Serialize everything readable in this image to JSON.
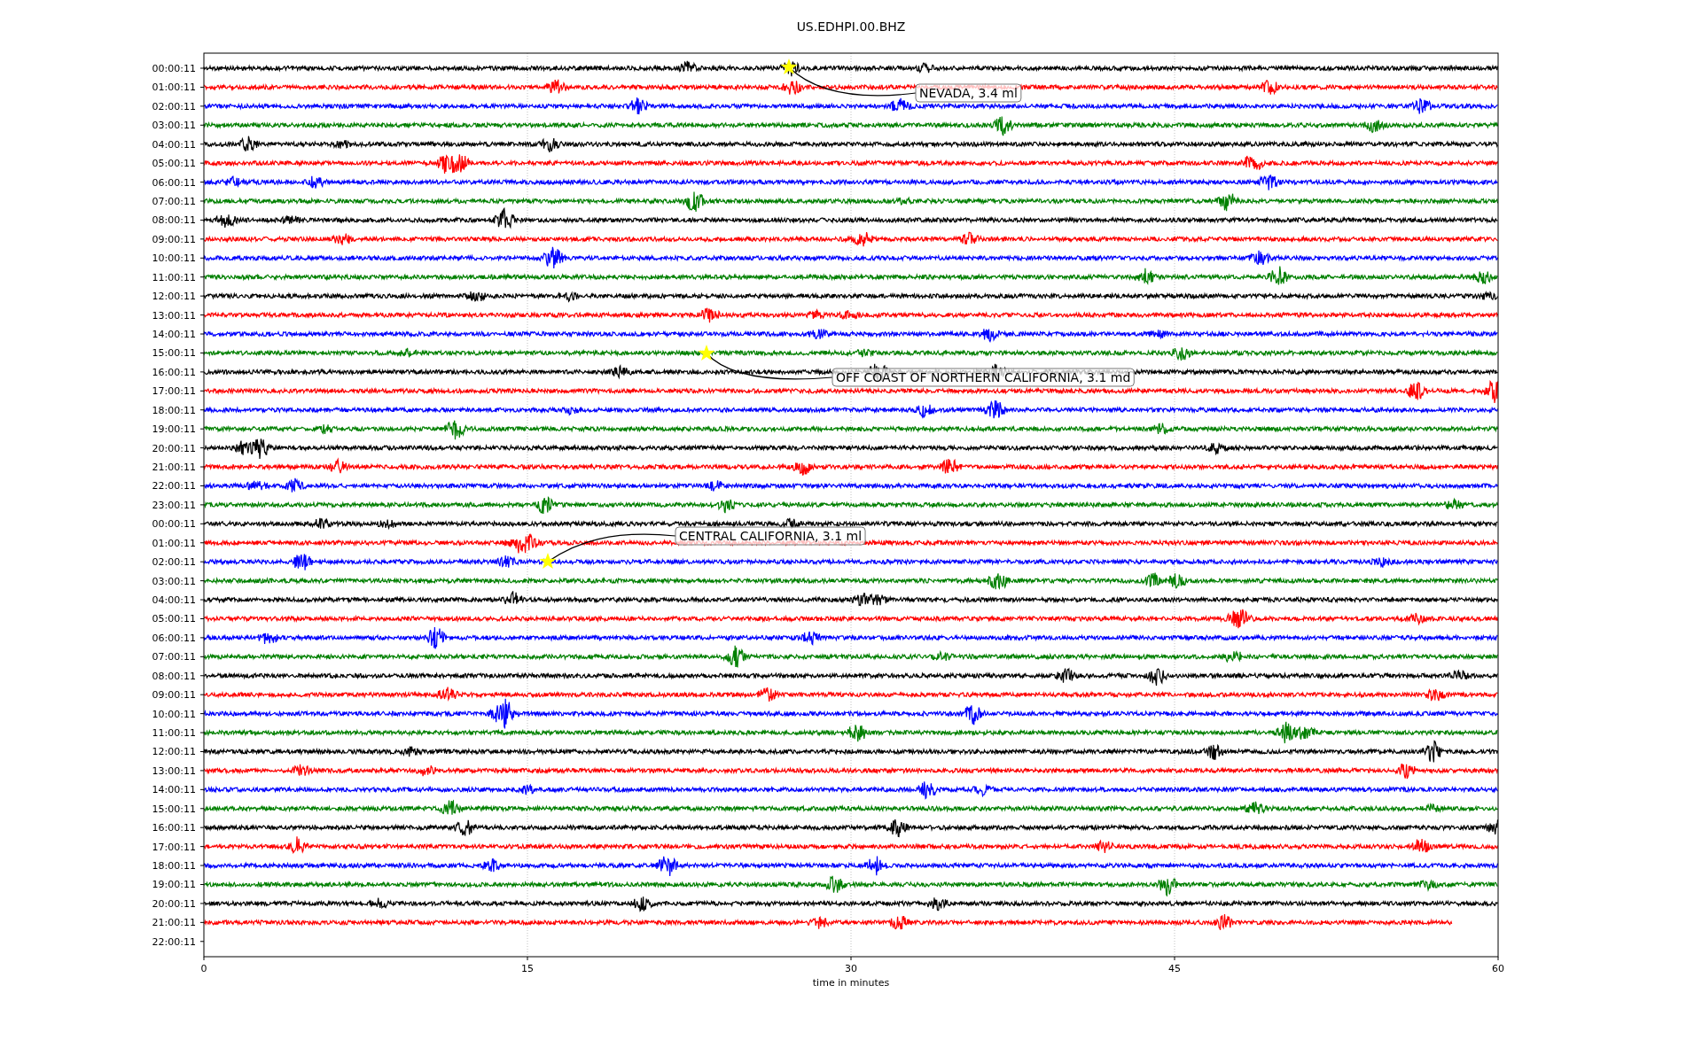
{
  "title": "US.EDHPI.00.BHZ",
  "rows": [
    {
      "label": "00:00:11",
      "color": "#000000",
      "kind": "full"
    },
    {
      "label": "01:00:11",
      "color": "#ff0000",
      "kind": "full"
    },
    {
      "label": "02:00:11",
      "color": "#0000ff",
      "kind": "full"
    },
    {
      "label": "03:00:11",
      "color": "#008000",
      "kind": "full"
    },
    {
      "label": "04:00:11",
      "color": "#000000",
      "kind": "full"
    },
    {
      "label": "05:00:11",
      "color": "#ff0000",
      "kind": "full"
    },
    {
      "label": "06:00:11",
      "color": "#0000ff",
      "kind": "full"
    },
    {
      "label": "07:00:11",
      "color": "#008000",
      "kind": "full"
    },
    {
      "label": "08:00:11",
      "color": "#000000",
      "kind": "full"
    },
    {
      "label": "09:00:11",
      "color": "#ff0000",
      "kind": "full"
    },
    {
      "label": "10:00:11",
      "color": "#0000ff",
      "kind": "full"
    },
    {
      "label": "11:00:11",
      "color": "#008000",
      "kind": "full"
    },
    {
      "label": "12:00:11",
      "color": "#000000",
      "kind": "full"
    },
    {
      "label": "13:00:11",
      "color": "#ff0000",
      "kind": "full"
    },
    {
      "label": "14:00:11",
      "color": "#0000ff",
      "kind": "full"
    },
    {
      "label": "15:00:11",
      "color": "#008000",
      "kind": "full"
    },
    {
      "label": "16:00:11",
      "color": "#000000",
      "kind": "full"
    },
    {
      "label": "17:00:11",
      "color": "#ff0000",
      "kind": "full"
    },
    {
      "label": "18:00:11",
      "color": "#0000ff",
      "kind": "full"
    },
    {
      "label": "19:00:11",
      "color": "#008000",
      "kind": "full"
    },
    {
      "label": "20:00:11",
      "color": "#000000",
      "kind": "full"
    },
    {
      "label": "21:00:11",
      "color": "#ff0000",
      "kind": "full"
    },
    {
      "label": "22:00:11",
      "color": "#0000ff",
      "kind": "full"
    },
    {
      "label": "23:00:11",
      "color": "#008000",
      "kind": "full"
    },
    {
      "label": "00:00:11",
      "color": "#000000",
      "kind": "full"
    },
    {
      "label": "01:00:11",
      "color": "#ff0000",
      "kind": "full"
    },
    {
      "label": "02:00:11",
      "color": "#0000ff",
      "kind": "full"
    },
    {
      "label": "03:00:11",
      "color": "#008000",
      "kind": "full"
    },
    {
      "label": "04:00:11",
      "color": "#000000",
      "kind": "full"
    },
    {
      "label": "05:00:11",
      "color": "#ff0000",
      "kind": "full"
    },
    {
      "label": "06:00:11",
      "color": "#0000ff",
      "kind": "full"
    },
    {
      "label": "07:00:11",
      "color": "#008000",
      "kind": "full"
    },
    {
      "label": "08:00:11",
      "color": "#000000",
      "kind": "full"
    },
    {
      "label": "09:00:11",
      "color": "#ff0000",
      "kind": "full"
    },
    {
      "label": "10:00:11",
      "color": "#0000ff",
      "kind": "full"
    },
    {
      "label": "11:00:11",
      "color": "#008000",
      "kind": "full"
    },
    {
      "label": "12:00:11",
      "color": "#000000",
      "kind": "full"
    },
    {
      "label": "13:00:11",
      "color": "#ff0000",
      "kind": "full"
    },
    {
      "label": "14:00:11",
      "color": "#0000ff",
      "kind": "full"
    },
    {
      "label": "15:00:11",
      "color": "#008000",
      "kind": "full"
    },
    {
      "label": "16:00:11",
      "color": "#000000",
      "kind": "full"
    },
    {
      "label": "17:00:11",
      "color": "#ff0000",
      "kind": "full"
    },
    {
      "label": "18:00:11",
      "color": "#0000ff",
      "kind": "full"
    },
    {
      "label": "19:00:11",
      "color": "#008000",
      "kind": "full"
    },
    {
      "label": "20:00:11",
      "color": "#000000",
      "kind": "full"
    },
    {
      "label": "21:00:11",
      "color": "#ff0000",
      "kind": "partial"
    },
    {
      "label": "22:00:11",
      "kind": "none"
    }
  ],
  "xticks": [
    "0",
    "15",
    "30",
    "45",
    "60"
  ],
  "xlabel": "time in minutes",
  "annotations": [
    "NEVADA, 3.4 ml",
    "OFF COAST OF NORTHERN CALIFORNIA, 3.1 md",
    "CENTRAL CALIFORNIA, 3.1 ml"
  ]
}
